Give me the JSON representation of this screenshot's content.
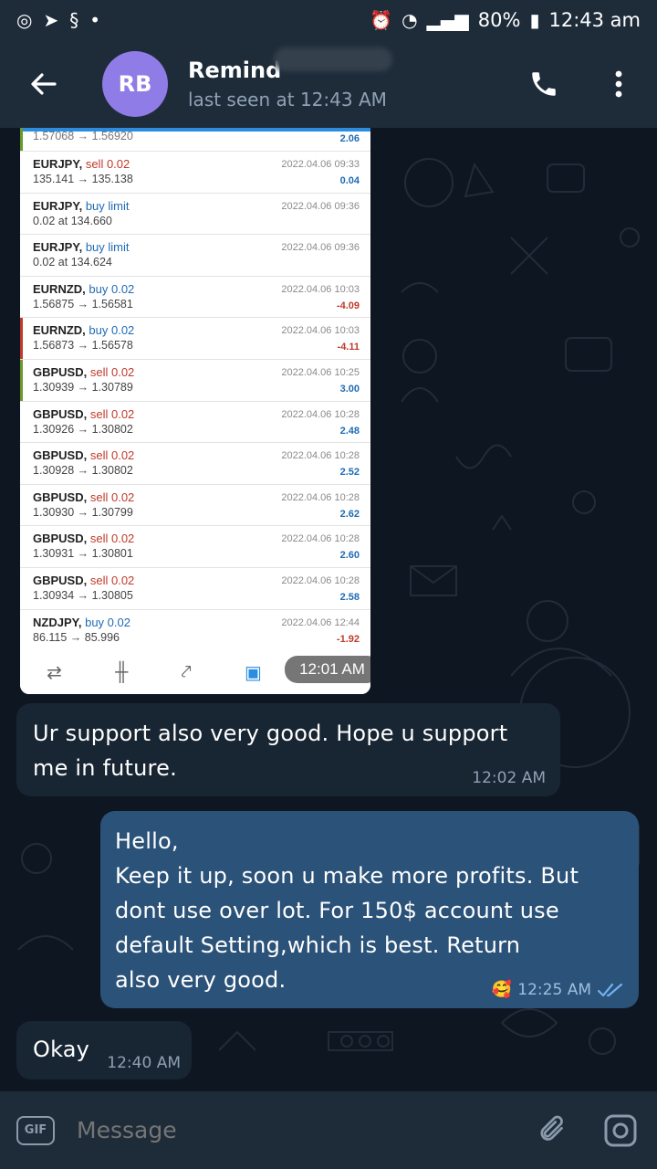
{
  "status_bar": {
    "battery": "80%",
    "time": "12:43 am"
  },
  "header": {
    "avatar_initials": "RB",
    "contact_name": "Remind",
    "last_seen": "last seen at 12:43 AM",
    "icons": [
      "back-arrow-icon",
      "phone-icon",
      "more-vert-icon"
    ]
  },
  "image_message": {
    "top_row": {
      "prices": "1.57068 → 1.56920",
      "profit": "2.06"
    },
    "trades": [
      {
        "symbol": "EURJPY,",
        "side": "sell 0.02",
        "side_type": "sell",
        "prices": "135.141 → 135.138",
        "time": "2022.04.06 09:33",
        "profit": "0.04",
        "profit_sign": "pos",
        "marker": ""
      },
      {
        "symbol": "EURJPY,",
        "side": "buy limit",
        "side_type": "buy",
        "prices": "0.02 at 134.660",
        "time": "2022.04.06 09:36",
        "profit": "",
        "profit_sign": "pos",
        "marker": ""
      },
      {
        "symbol": "EURJPY,",
        "side": "buy limit",
        "side_type": "buy",
        "prices": "0.02 at 134.624",
        "time": "2022.04.06 09:36",
        "profit": "",
        "profit_sign": "pos",
        "marker": ""
      },
      {
        "symbol": "EURNZD,",
        "side": "buy 0.02",
        "side_type": "buy",
        "prices": "1.56875 → 1.56581",
        "time": "2022.04.06 10:03",
        "profit": "-4.09",
        "profit_sign": "neg",
        "marker": ""
      },
      {
        "symbol": "EURNZD,",
        "side": "buy 0.02",
        "side_type": "buy",
        "prices": "1.56873 → 1.56578",
        "time": "2022.04.06 10:03",
        "profit": "-4.11",
        "profit_sign": "neg",
        "marker": "red"
      },
      {
        "symbol": "GBPUSD,",
        "side": "sell 0.02",
        "side_type": "sell",
        "prices": "1.30939 → 1.30789",
        "time": "2022.04.06 10:25",
        "profit": "3.00",
        "profit_sign": "pos",
        "marker": "green"
      },
      {
        "symbol": "GBPUSD,",
        "side": "sell 0.02",
        "side_type": "sell",
        "prices": "1.30926 → 1.30802",
        "time": "2022.04.06 10:28",
        "profit": "2.48",
        "profit_sign": "pos",
        "marker": ""
      },
      {
        "symbol": "GBPUSD,",
        "side": "sell 0.02",
        "side_type": "sell",
        "prices": "1.30928 → 1.30802",
        "time": "2022.04.06 10:28",
        "profit": "2.52",
        "profit_sign": "pos",
        "marker": ""
      },
      {
        "symbol": "GBPUSD,",
        "side": "sell 0.02",
        "side_type": "sell",
        "prices": "1.30930 → 1.30799",
        "time": "2022.04.06 10:28",
        "profit": "2.62",
        "profit_sign": "pos",
        "marker": ""
      },
      {
        "symbol": "GBPUSD,",
        "side": "sell 0.02",
        "side_type": "sell",
        "prices": "1.30931 → 1.30801",
        "time": "2022.04.06 10:28",
        "profit": "2.60",
        "profit_sign": "pos",
        "marker": ""
      },
      {
        "symbol": "GBPUSD,",
        "side": "sell 0.02",
        "side_type": "sell",
        "prices": "1.30934 → 1.30805",
        "time": "2022.04.06 10:28",
        "profit": "2.58",
        "profit_sign": "pos",
        "marker": ""
      },
      {
        "symbol": "NZDJPY,",
        "side": "buy 0.02",
        "side_type": "buy",
        "prices": "86.115 → 85.996",
        "time": "2022.04.06 12:44",
        "profit": "-1.92",
        "profit_sign": "neg",
        "marker": ""
      }
    ],
    "sent_time": "12:01 AM"
  },
  "messages": [
    {
      "id": "m1",
      "direction": "incoming",
      "text": "Ur support also very good. Hope u support\nme in future.",
      "time": "12:02 AM"
    },
    {
      "id": "m2",
      "direction": "outgoing",
      "text": "Hello,\nKeep it up, soon u make more profits. But\ndont use over lot. For 150$ account use\ndefault Setting,which is best. Return\nalso very good.",
      "time": "12:25 AM",
      "reaction": "🥰"
    },
    {
      "id": "m3",
      "direction": "incoming",
      "text": "Okay",
      "time": "12:40 AM"
    }
  ],
  "composer": {
    "gif_label": "GIF",
    "placeholder": "Message"
  },
  "colors": {
    "header_bg": "#1e2c3a",
    "chat_bg": "#0e1621",
    "incoming_bubble": "#182533",
    "outgoing_bubble": "#2b5278",
    "avatar": "#8f7ce6"
  }
}
